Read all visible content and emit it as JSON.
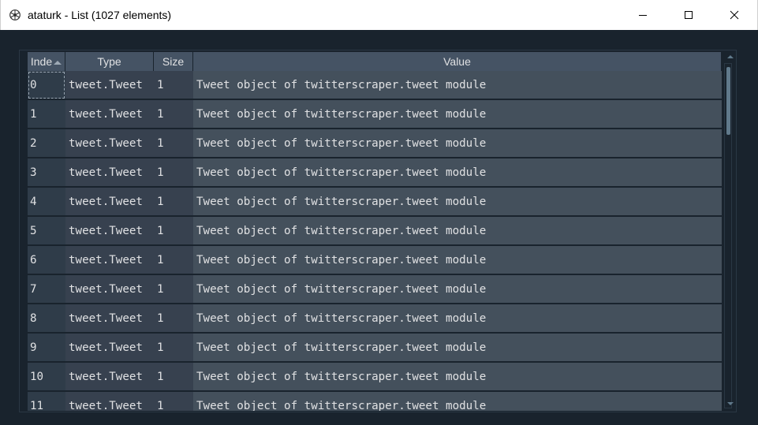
{
  "window": {
    "title": "ataturk - List (1027 elements)",
    "app_icon": "spyder-icon",
    "controls": [
      "minimize-icon",
      "maximize-icon",
      "close-icon"
    ]
  },
  "table": {
    "headers": {
      "index": "Inde",
      "type": "Type",
      "size": "Size",
      "value": "Value"
    },
    "sort_indicator": "sort-ascending-icon",
    "rows": [
      {
        "index": "0",
        "type": "tweet.Tweet",
        "size": "1",
        "value": "Tweet object of twitterscraper.tweet module"
      },
      {
        "index": "1",
        "type": "tweet.Tweet",
        "size": "1",
        "value": "Tweet object of twitterscraper.tweet module"
      },
      {
        "index": "2",
        "type": "tweet.Tweet",
        "size": "1",
        "value": "Tweet object of twitterscraper.tweet module"
      },
      {
        "index": "3",
        "type": "tweet.Tweet",
        "size": "1",
        "value": "Tweet object of twitterscraper.tweet module"
      },
      {
        "index": "4",
        "type": "tweet.Tweet",
        "size": "1",
        "value": "Tweet object of twitterscraper.tweet module"
      },
      {
        "index": "5",
        "type": "tweet.Tweet",
        "size": "1",
        "value": "Tweet object of twitterscraper.tweet module"
      },
      {
        "index": "6",
        "type": "tweet.Tweet",
        "size": "1",
        "value": "Tweet object of twitterscraper.tweet module"
      },
      {
        "index": "7",
        "type": "tweet.Tweet",
        "size": "1",
        "value": "Tweet object of twitterscraper.tweet module"
      },
      {
        "index": "8",
        "type": "tweet.Tweet",
        "size": "1",
        "value": "Tweet object of twitterscraper.tweet module"
      },
      {
        "index": "9",
        "type": "tweet.Tweet",
        "size": "1",
        "value": "Tweet object of twitterscraper.tweet module"
      },
      {
        "index": "10",
        "type": "tweet.Tweet",
        "size": "1",
        "value": "Tweet object of twitterscraper.tweet module"
      },
      {
        "index": "11",
        "type": "tweet.Tweet",
        "size": "1",
        "value": "Tweet object of twitterscraper.tweet module"
      }
    ]
  },
  "colors": {
    "background": "#19232d",
    "header": "#455364",
    "value_cell": "#44505c",
    "type_cell": "#37414f",
    "index_cell": "#2f3c49",
    "text": "#e0e1e3"
  }
}
